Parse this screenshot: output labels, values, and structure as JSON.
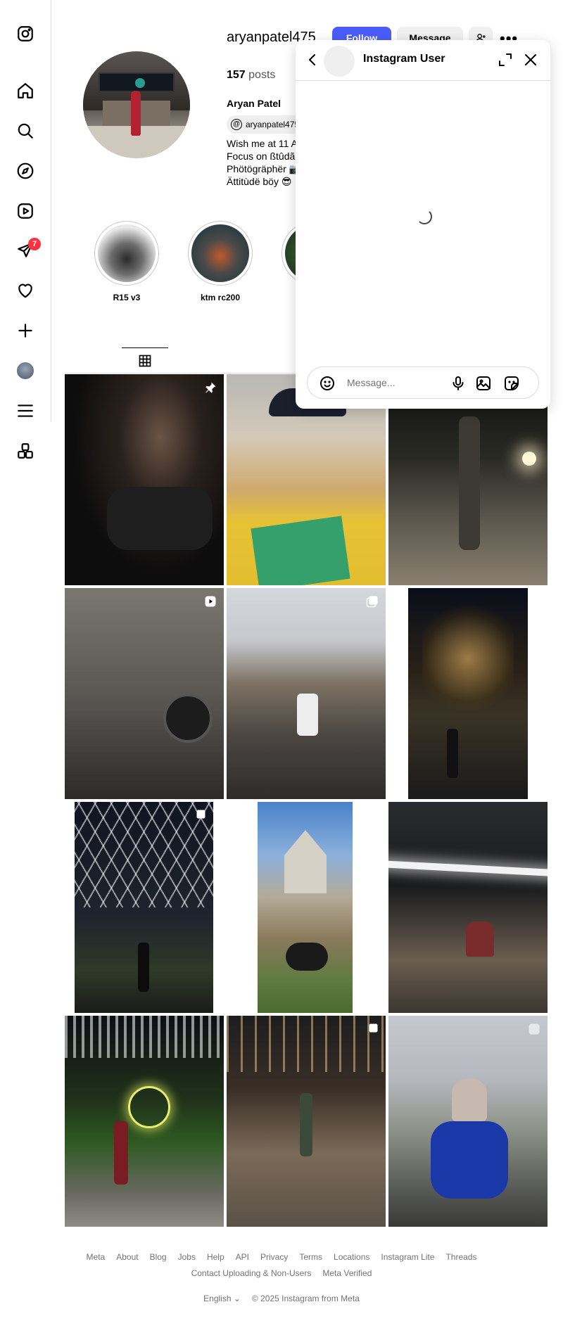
{
  "profile": {
    "username": "aryanpatel475",
    "full_name": "Aryan Patel",
    "posts_count": "157",
    "posts_label": "posts",
    "threads_handle": "aryanpatel475",
    "bio": [
      "Wish me at 11 A",
      "Focus on ßtûdã",
      "Phötögräphër 📷",
      "Ättitùdë böy 😎"
    ],
    "follow_label": "Follow",
    "message_label": "Message"
  },
  "sidebar": {
    "notification_count": "7",
    "icons": [
      "instagram-logo-icon",
      "home-icon",
      "search-icon",
      "explore-icon",
      "reels-icon",
      "messages-icon",
      "notifications-icon",
      "create-icon",
      "profile-avatar",
      "menu-icon",
      "more-apps-icon"
    ]
  },
  "highlights": [
    {
      "label": "R15 v3"
    },
    {
      "label": "ktm rc200"
    },
    {
      "label": ""
    }
  ],
  "dm": {
    "title": "Instagram User",
    "placeholder": "Message..."
  },
  "footer": {
    "links_row1": [
      "Meta",
      "About",
      "Blog",
      "Jobs",
      "Help",
      "API",
      "Privacy",
      "Terms",
      "Locations",
      "Instagram Lite",
      "Threads"
    ],
    "links_row2": [
      "Contact Uploading & Non-Users",
      "Meta Verified"
    ],
    "language": "English",
    "copyright": "© 2025 Instagram from Meta"
  },
  "colors": {
    "follow_blue": "#4a5df9",
    "badge_red": "#ff3040",
    "border": "#dbdbdb",
    "muted": "#737373"
  }
}
